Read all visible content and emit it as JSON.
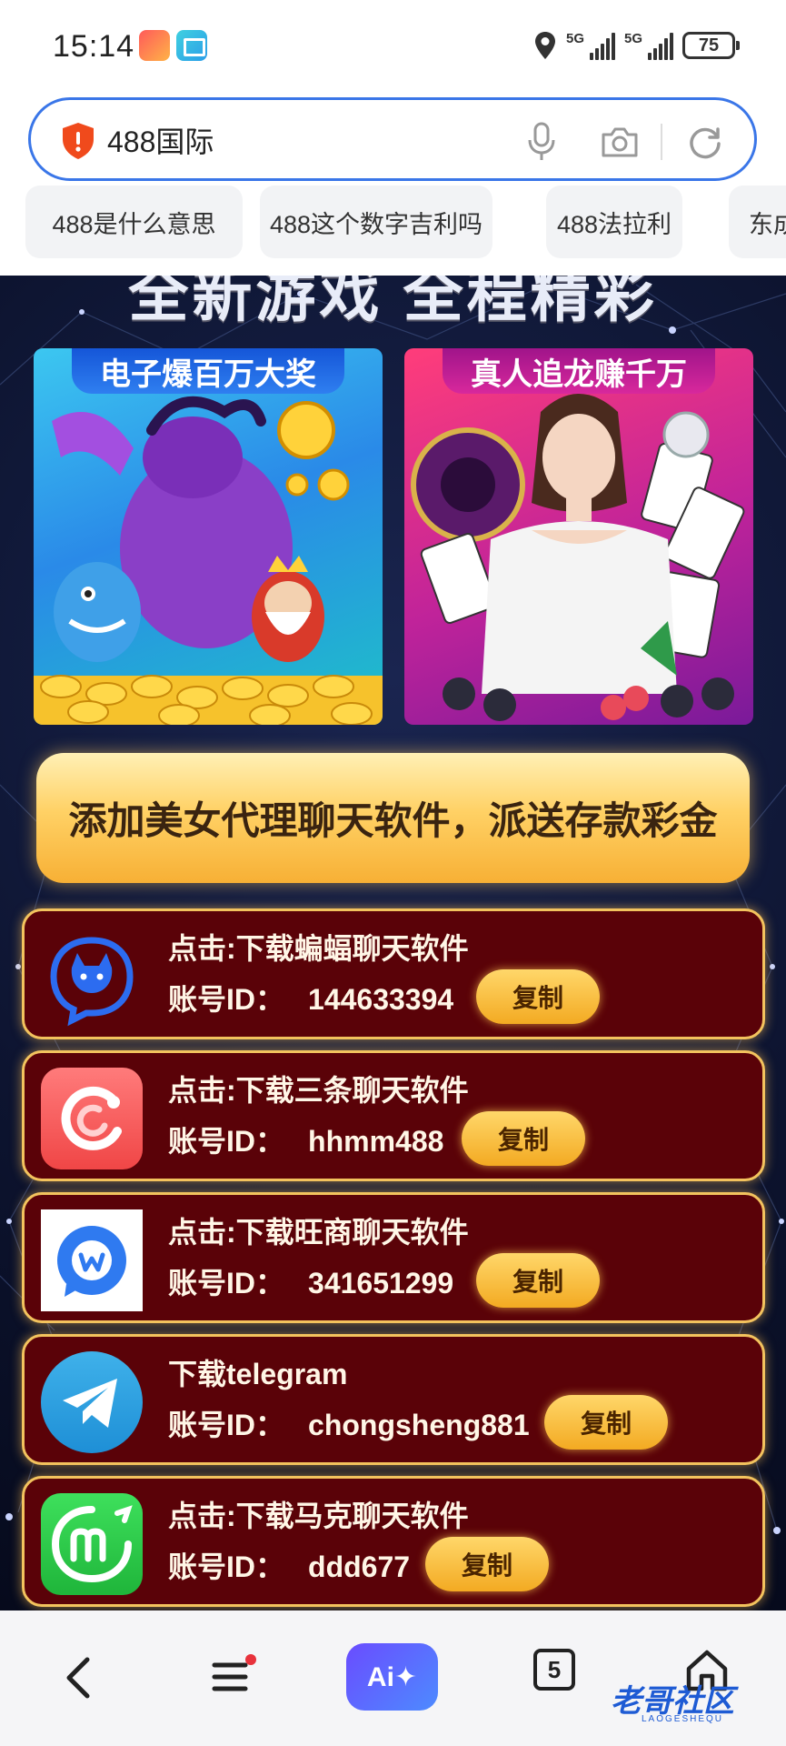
{
  "status_bar": {
    "time": "15:14",
    "network_1": "5G",
    "network_2": "5G",
    "battery": "75"
  },
  "search": {
    "query": "488国际"
  },
  "suggestions": [
    {
      "label": "488是什么意思"
    },
    {
      "label": "488这个数字吉利吗"
    },
    {
      "label": "488法拉利"
    },
    {
      "label": "东成"
    }
  ],
  "page": {
    "banner_title": "全新游戏 全程精彩",
    "promo_left": "电子爆百万大奖",
    "promo_right": "真人追龙赚千万",
    "cta": "添加美女代理聊天软件，派送存款彩金",
    "id_label": "账号ID：",
    "copy_label": "复制",
    "rows": [
      {
        "title": "点击:下载蝙蝠聊天软件",
        "account_id": "144633394"
      },
      {
        "title": "点击:下载三条聊天软件",
        "account_id": "hhmm488"
      },
      {
        "title": "点击:下载旺商聊天软件",
        "account_id": "341651299"
      },
      {
        "title": "下载telegram",
        "account_id": "chongsheng881"
      },
      {
        "title": "点击:下载马克聊天软件",
        "account_id": "ddd677"
      }
    ]
  },
  "bottom_nav": {
    "ai_label": "Ai✦",
    "tab_count": "5",
    "watermark": "老哥社区",
    "watermark_sub": "LAOGESHEQU"
  },
  "colors": {
    "accent": "#3a76e8",
    "row_bg": "#5a0208",
    "row_border": "#f3c35e",
    "copy_button": "#f3aa22"
  }
}
